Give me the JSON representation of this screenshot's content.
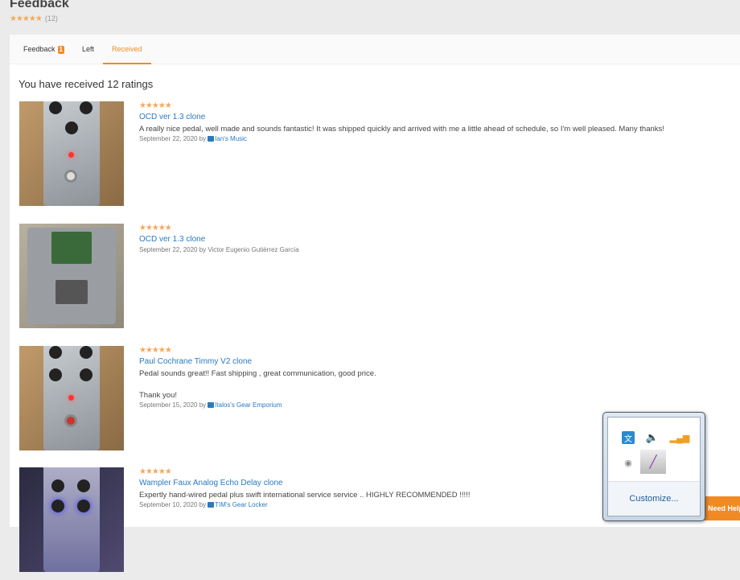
{
  "page": {
    "title": "Feedback",
    "stars": "★★★★★",
    "count": "(12)"
  },
  "tabs": [
    {
      "label": "Feedback",
      "badge": "1"
    },
    {
      "label": "Left"
    },
    {
      "label": "Received"
    }
  ],
  "heading": "You have received 12 ratings",
  "reviews": [
    {
      "stars": "★★★★★",
      "title": "OCD ver 1.3 clone",
      "body": "A really nice pedal, well made and sounds fantastic! It was shipped quickly and arrived with me a little ahead of schedule, so I'm well pleased. Many thanks!",
      "date": "September 22, 2020 by",
      "author": "Ian's Music"
    },
    {
      "stars": "★★★★★",
      "title": "OCD ver 1.3 clone",
      "body": "",
      "date": "September 22, 2020 by Victor Eugenio Gutiérrez García",
      "author": ""
    },
    {
      "stars": "★★★★★",
      "title": "Paul Cochrane Timmy V2 clone",
      "body": "Pedal sounds great!! Fast shipping , great communication, good price.\n\nThank you!\n",
      "date": "September 15, 2020 by",
      "author": "Italos's Gear Emporium"
    },
    {
      "stars": "★★★★★",
      "title": "Wampler Faux Analog Echo Delay clone",
      "body": "Expertly hand-wired pedal plus swift international service service .. HIGHLY RECOMMENDED !!!!!",
      "date": "September 10, 2020 by",
      "author": "TIM's Gear Locker"
    }
  ],
  "tray": {
    "customize": "Customize..."
  },
  "help": {
    "label": "Need Help"
  },
  "colors": {
    "accent": "#f08a24",
    "link": "#2a7ac0",
    "star": "#f5a85a"
  }
}
